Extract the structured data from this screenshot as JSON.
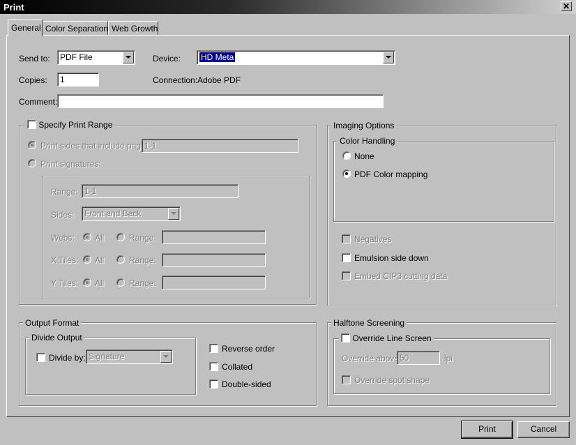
{
  "window": {
    "title": "Print",
    "close_glyph": "✕"
  },
  "tabs": [
    {
      "label": "General"
    },
    {
      "label": "Color Separations"
    },
    {
      "label": "Web Growth"
    }
  ],
  "general": {
    "send_to_label": "Send to:",
    "send_to_value": "PDF File",
    "device_label": "Device:",
    "device_value": "HD Meta",
    "copies_label": "Copies:",
    "copies_value": "1",
    "connection_label": "Connection:",
    "connection_value": "Adobe PDF",
    "comment_label": "Comment:",
    "comment_value": ""
  },
  "print_range": {
    "checkbox_label": "Specify Print Range",
    "sides_radio_label": "Print sides that include pages:",
    "sides_value": "1-1",
    "signatures_radio_label": "Print signatures:",
    "range_label": "Range:",
    "range_value": "1-1",
    "sides_label": "Sides:",
    "sides_select": "Front and Back",
    "webs_label": "Webs:",
    "xtiles_label": "X Tiles:",
    "ytiles_label": "Y Tiles:",
    "all_label": "All",
    "range_radio_label": "Range:"
  },
  "imaging": {
    "legend": "Imaging Options",
    "color_handling_legend": "Color Handling",
    "none_label": "None",
    "pdf_color_label": "PDF Color mapping",
    "negatives_label": "Negatives",
    "emulsion_label": "Emulsion side down",
    "cip3_label": "Embed CIP3 cutting data"
  },
  "output": {
    "legend": "Output Format",
    "divide_legend": "Divide Output",
    "divide_by_label": "Divide by:",
    "divide_by_value": "Signature",
    "reverse_label": "Reverse order",
    "collated_label": "Collated",
    "double_sided_label": "Double-sided"
  },
  "halftone": {
    "legend": "Halftone Screening",
    "override_label": "Override Line Screen",
    "override_above_label": "Override above:",
    "override_above_value": "50",
    "lpi_label": "lpi",
    "spot_label": "Override spot shape"
  },
  "buttons": {
    "print": "Print",
    "cancel": "Cancel"
  }
}
